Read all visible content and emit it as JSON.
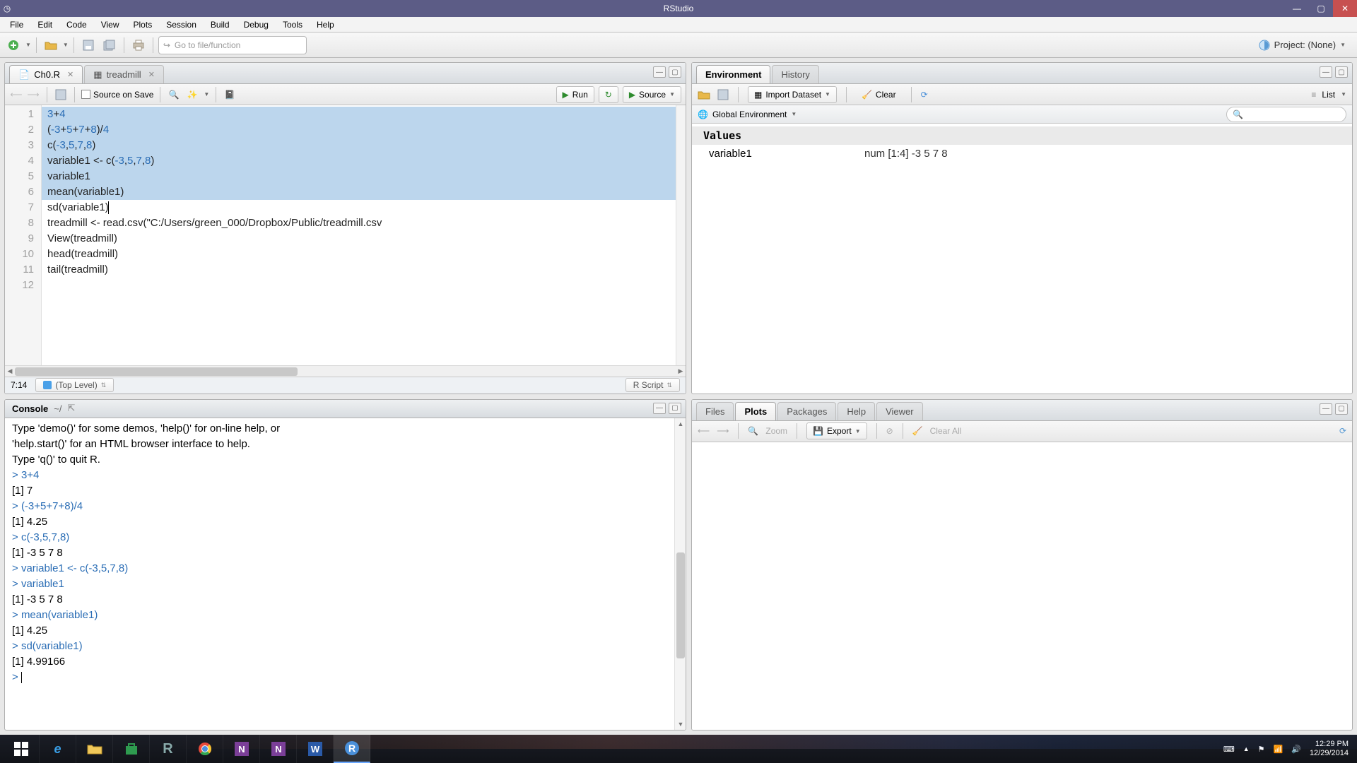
{
  "app": {
    "title": "RStudio"
  },
  "menu": [
    "File",
    "Edit",
    "Code",
    "View",
    "Plots",
    "Session",
    "Build",
    "Debug",
    "Tools",
    "Help"
  ],
  "toolbar": {
    "goto_placeholder": "Go to file/function",
    "project_label": "Project: (None)"
  },
  "editor": {
    "tabs": [
      {
        "label": "Ch0.R",
        "active": true,
        "closable": true
      },
      {
        "label": "treadmill",
        "active": false,
        "closable": true
      }
    ],
    "source_on_save": "Source on Save",
    "run": "Run",
    "source": "Source",
    "cursor": "7:14",
    "toplevel": "(Top Level)",
    "lang": "R Script",
    "lines": [
      "3+4",
      "(-3+5+7+8)/4",
      "c(-3,5,7,8)",
      "variable1 <- c(-3,5,7,8)",
      "variable1",
      "mean(variable1)",
      "sd(variable1)",
      "treadmill <- read.csv(\"C:/Users/green_000/Dropbox/Public/treadmill.csv",
      "View(treadmill)",
      "head(treadmill)",
      "tail(treadmill)",
      ""
    ],
    "selected_max_line": 6
  },
  "console": {
    "title": "Console",
    "wd": "~/",
    "intro": [
      "Type 'demo()' for some demos, 'help()' for on-line help, or",
      "'help.start()' for an HTML browser interface to help.",
      "Type 'q()' to quit R.",
      ""
    ],
    "io": [
      {
        "in": "3+4",
        "out": "[1] 7"
      },
      {
        "in": "(-3+5+7+8)/4",
        "out": "[1] 4.25"
      },
      {
        "in": "c(-3,5,7,8)",
        "out": "[1] -3  5  7  8"
      },
      {
        "in": "variable1 <- c(-3,5,7,8)",
        "out": null
      },
      {
        "in": "variable1",
        "out": "[1] -3  5  7  8"
      },
      {
        "in": "mean(variable1)",
        "out": "[1] 4.25"
      },
      {
        "in": "sd(variable1)",
        "out": "[1] 4.99166"
      }
    ],
    "prompt": ">"
  },
  "env": {
    "tabs": [
      "Environment",
      "History"
    ],
    "import": "Import Dataset",
    "clear": "Clear",
    "list": "List",
    "scope": "Global Environment",
    "section": "Values",
    "rows": [
      {
        "name": "variable1",
        "value": "num [1:4] -3 5 7 8"
      }
    ]
  },
  "br": {
    "tabs": [
      "Files",
      "Plots",
      "Packages",
      "Help",
      "Viewer"
    ],
    "active": "Plots",
    "zoom": "Zoom",
    "export": "Export",
    "clear_all": "Clear All"
  },
  "windows": {
    "time": "12:29 PM",
    "date": "12/29/2014"
  }
}
